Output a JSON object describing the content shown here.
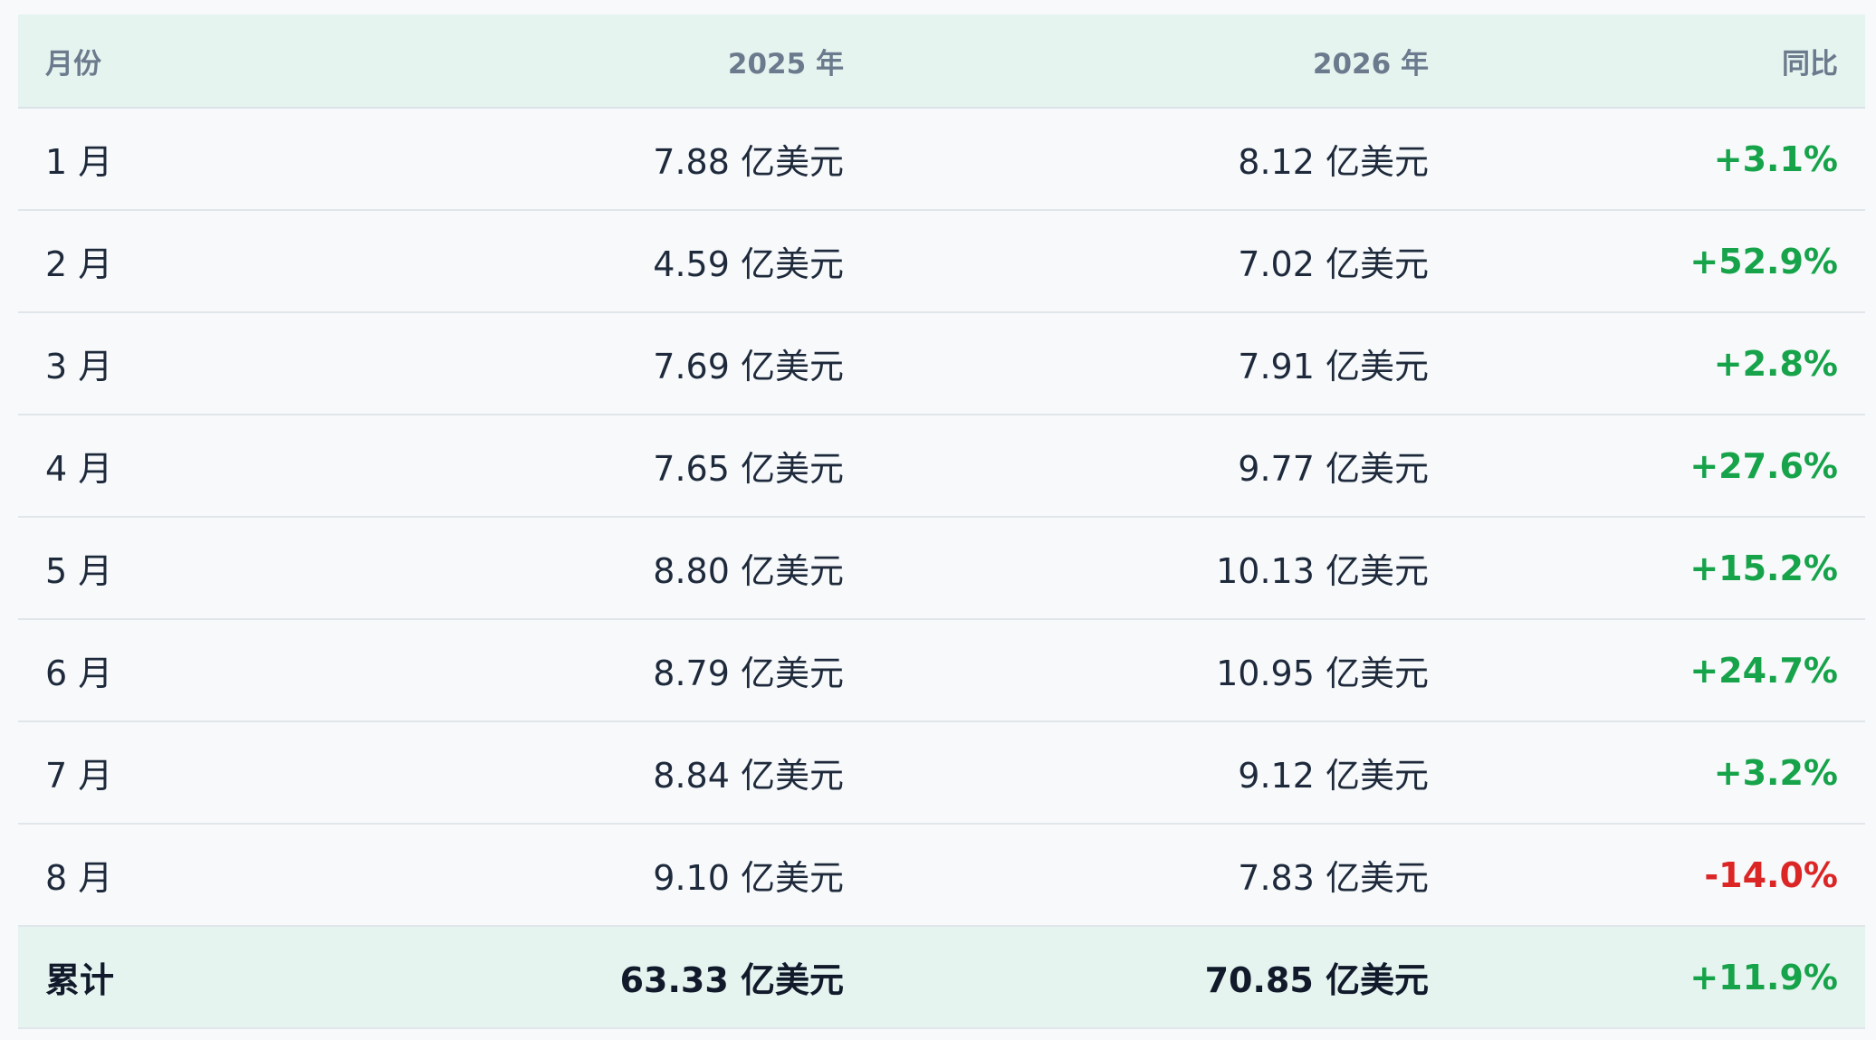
{
  "table": {
    "headers": {
      "month": "月份",
      "y2025": "2025 年",
      "y2026": "2026 年",
      "yoy": "同比"
    },
    "rows": [
      {
        "month": "1 月",
        "y2025": "7.88 亿美元",
        "y2026": "8.12 亿美元",
        "yoy": "+3.1%"
      },
      {
        "month": "2 月",
        "y2025": "4.59 亿美元",
        "y2026": "7.02 亿美元",
        "yoy": "+52.9%"
      },
      {
        "month": "3 月",
        "y2025": "7.69 亿美元",
        "y2026": "7.91 亿美元",
        "yoy": "+2.8%"
      },
      {
        "month": "4 月",
        "y2025": "7.65 亿美元",
        "y2026": "9.77 亿美元",
        "yoy": "+27.6%"
      },
      {
        "month": "5 月",
        "y2025": "8.80 亿美元",
        "y2026": "10.13 亿美元",
        "yoy": "+15.2%"
      },
      {
        "month": "6 月",
        "y2025": "8.79 亿美元",
        "y2026": "10.95 亿美元",
        "yoy": "+24.7%"
      },
      {
        "month": "7 月",
        "y2025": "8.84 亿美元",
        "y2026": "9.12 亿美元",
        "yoy": "+3.2%"
      },
      {
        "month": "8 月",
        "y2025": "9.10 亿美元",
        "y2026": "7.83 亿美元",
        "yoy": "-14.0%"
      }
    ],
    "total": {
      "month": "累计",
      "y2025": "63.33 亿美元",
      "y2026": "70.85 亿美元",
      "yoy": "+11.9%"
    }
  },
  "colors": {
    "positive": "#16a34a",
    "negative": "#dc2626",
    "header_bg": "#e6f4f0",
    "page_bg": "#f7f9fb"
  }
}
